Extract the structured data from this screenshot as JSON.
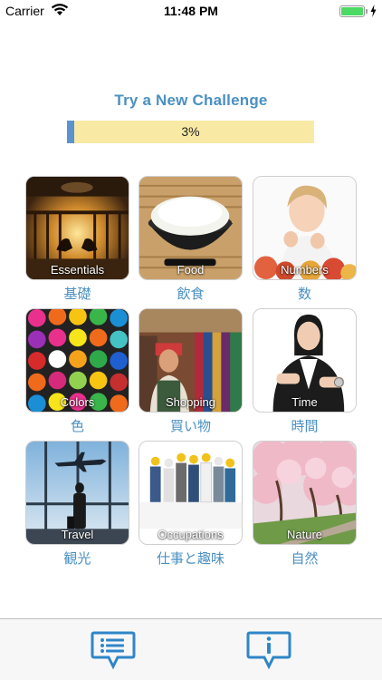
{
  "status_bar": {
    "carrier": "Carrier",
    "time": "11:48 PM"
  },
  "challenge": {
    "title": "Try a New Challenge",
    "progress_text": "3%",
    "progress_fraction": 0.03
  },
  "categories": [
    {
      "label": "Essentials",
      "jp": "基礎",
      "icon": "essentials-photo"
    },
    {
      "label": "Food",
      "jp": "飲食",
      "icon": "rice-bowl-photo"
    },
    {
      "label": "Numbers",
      "jp": "数",
      "icon": "child-counting-photo"
    },
    {
      "label": "Colors",
      "jp": "色",
      "icon": "paint-cans-photo"
    },
    {
      "label": "Shopping",
      "jp": "買い物",
      "icon": "shop-vendor-photo"
    },
    {
      "label": "Time",
      "jp": "時間",
      "icon": "wristwatch-photo"
    },
    {
      "label": "Travel",
      "jp": "観光",
      "icon": "airport-traveler-photo"
    },
    {
      "label": "Occupations",
      "jp": "仕事と趣味",
      "icon": "workers-group-photo"
    },
    {
      "label": "Nature",
      "jp": "自然",
      "icon": "cherry-blossom-photo"
    }
  ],
  "colors": {
    "accent": "#4a90c2",
    "progress_track": "#f8eaa5",
    "progress_fill": "#5a93cf",
    "battery": "#4cd964"
  },
  "bottom_bar": {
    "left_icon": "chat-list-icon",
    "right_icon": "info-bubble-icon"
  }
}
